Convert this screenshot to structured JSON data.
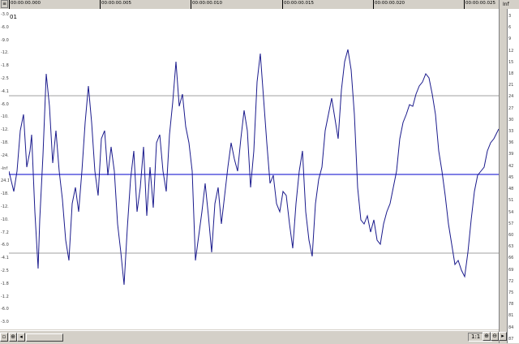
{
  "ruler": {
    "corner_label": "≡",
    "ticks": [
      "00:00:00.000",
      "00:00:00.005",
      "00:00:00.010",
      "00:00:00.015",
      "00:00:00.020",
      "00:00:00.025"
    ]
  },
  "track": {
    "id": "01"
  },
  "left_scale": [
    "-3.0",
    "-6.0",
    "-9.0",
    "-12.0",
    "-1.8",
    "-2.5",
    "-4.1",
    "-6.0",
    "-10.1",
    "-12.0",
    "-18.5",
    "-24.1",
    "-Inf",
    "24.1",
    "-18.5",
    "-12.0",
    "-10.1",
    "-7.2",
    "-6.0",
    "-4.1",
    "-2.5",
    "-1.8",
    "-1.2",
    "-6.0",
    "-3.0"
  ],
  "right_scale": {
    "unit": "Inf",
    "values": [
      "3",
      "6",
      "9",
      "12",
      "15",
      "18",
      "21",
      "24",
      "27",
      "30",
      "33",
      "36",
      "39",
      "42",
      "45",
      "48",
      "51",
      "54",
      "57",
      "60",
      "63",
      "66",
      "69",
      "72",
      "75",
      "78",
      "81",
      "84",
      "87"
    ]
  },
  "statusbar": {
    "zoom": "1:1",
    "left_arrow": "◂",
    "zoom_icon": "⊕"
  },
  "colors": {
    "waveform": "#1a1a8c",
    "center_line": "#0000cc",
    "guide_line": "#a0a0a0",
    "chrome": "#d4d0c8"
  }
}
